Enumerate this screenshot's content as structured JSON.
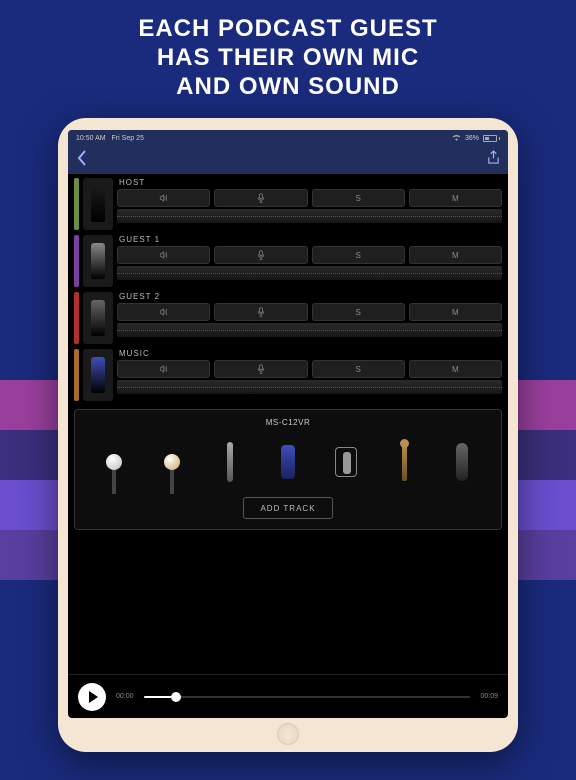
{
  "promo": {
    "line1": "EACH PODCAST GUEST",
    "line2": "HAS THEIR OWN MIC",
    "line3": "AND OWN SOUND"
  },
  "statusbar": {
    "time": "10:50 AM",
    "date": "Fri Sep 25",
    "battery_pct": "36%"
  },
  "tracks": [
    {
      "label": "HOST",
      "color": "#6b8f3f",
      "mic_color": "#1a1a1a",
      "s_label": "S",
      "m_label": "M"
    },
    {
      "label": "GUEST 1",
      "color": "#7a3fa0",
      "mic_color": "#888",
      "s_label": "S",
      "m_label": "M"
    },
    {
      "label": "GUEST 2",
      "color": "#b33030",
      "mic_color": "#666",
      "s_label": "S",
      "m_label": "M"
    },
    {
      "label": "MUSIC",
      "color": "#a86b2f",
      "mic_color": "#3f4fb8",
      "s_label": "S",
      "m_label": "M"
    }
  ],
  "mic_picker": {
    "title": "MS-C12VR",
    "mics": [
      {
        "name": "mic-round-silver",
        "color": "#bbb",
        "shape": "ball"
      },
      {
        "name": "mic-round-gold",
        "color": "#c9a55f",
        "shape": "ball"
      },
      {
        "name": "mic-pencil",
        "color": "#888",
        "shape": "pencil"
      },
      {
        "name": "mic-blue-studio",
        "color": "#3f4fb8",
        "shape": "studio"
      },
      {
        "name": "mic-shock-mount",
        "color": "#999",
        "shape": "shock"
      },
      {
        "name": "mic-brass",
        "color": "#b89050",
        "shape": "stick"
      },
      {
        "name": "mic-tube",
        "color": "#555",
        "shape": "tube"
      }
    ]
  },
  "add_track_label": "ADD TRACK",
  "player": {
    "current": "00:00",
    "duration": "00:09"
  }
}
